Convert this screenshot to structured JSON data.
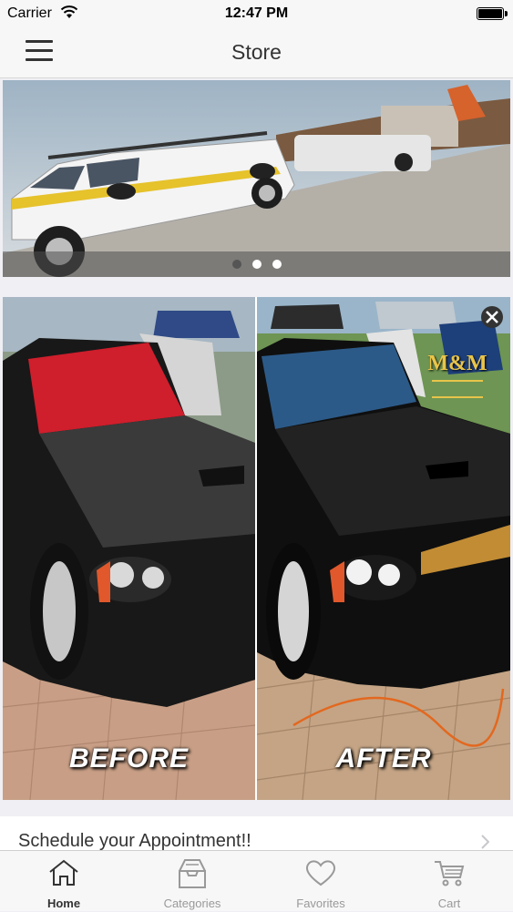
{
  "status_bar": {
    "carrier": "Carrier",
    "time": "12:47 PM"
  },
  "nav": {
    "title": "Store"
  },
  "carousel": {
    "slide_count": 3,
    "active_index": 0
  },
  "promo": {
    "before_label": "BEFORE",
    "after_label": "AFTER",
    "logo_text": "M&M"
  },
  "appointment": {
    "label": "Schedule your Appointment!!"
  },
  "tabs": [
    {
      "label": "Home",
      "icon": "home-icon",
      "active": true
    },
    {
      "label": "Categories",
      "icon": "categories-icon",
      "active": false
    },
    {
      "label": "Favorites",
      "icon": "heart-icon",
      "active": false
    },
    {
      "label": "Cart",
      "icon": "cart-icon",
      "active": false
    }
  ],
  "colors": {
    "accent_active": "#333333",
    "tab_inactive": "#999999",
    "background": "#efeff4"
  }
}
